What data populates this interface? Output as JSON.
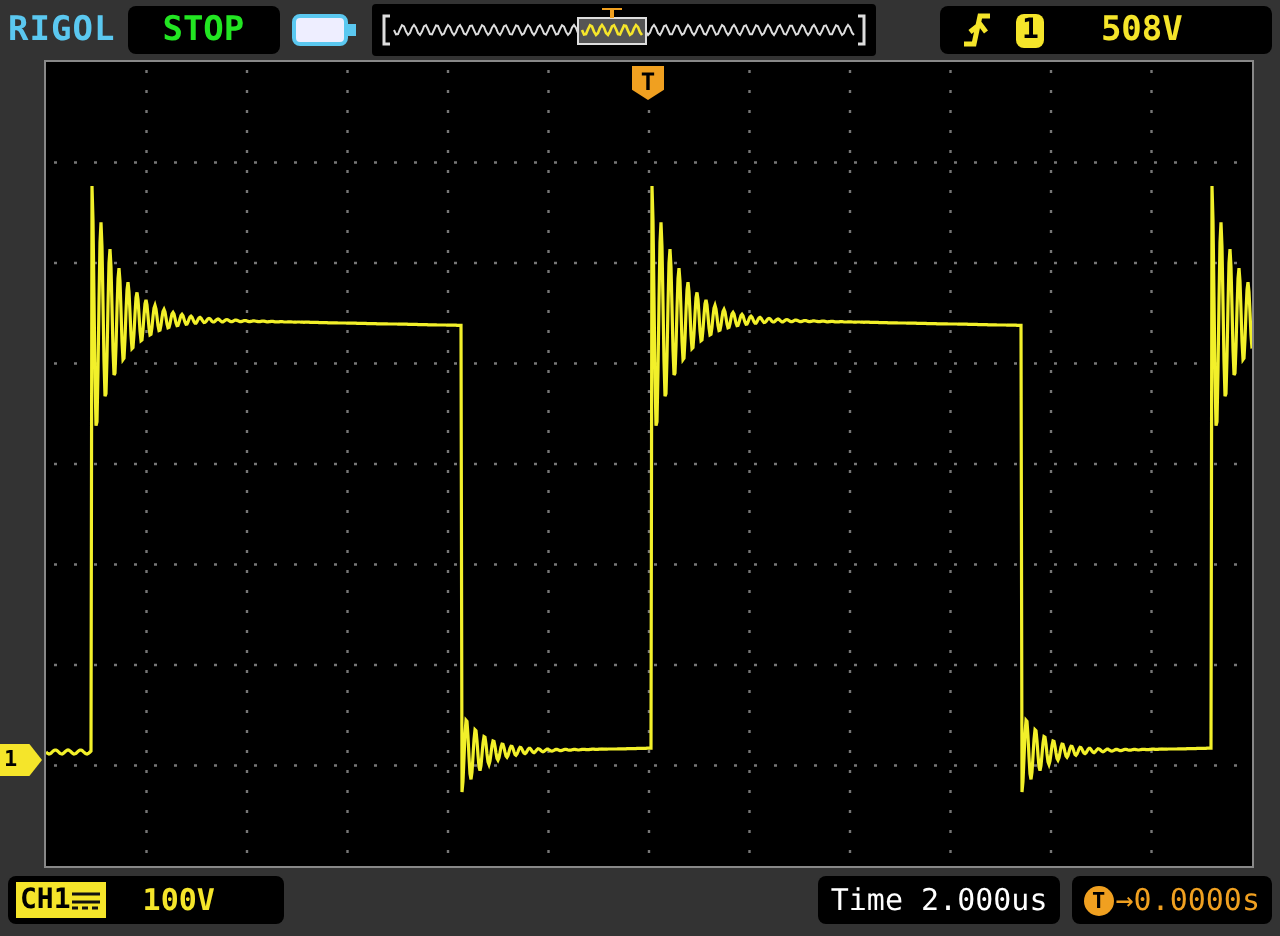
{
  "brand": "RIGOL",
  "run_state": {
    "label": "STOP",
    "kind": "stop"
  },
  "trigger": {
    "channel": "1",
    "level": "508V"
  },
  "trigger_marker": "T",
  "channel_marker": "1",
  "channel": {
    "name": "CH1",
    "scale": "100V"
  },
  "timebase": "Time 2.000us",
  "trigger_offset": {
    "marker": "T",
    "value": "→0.0000s"
  }
}
